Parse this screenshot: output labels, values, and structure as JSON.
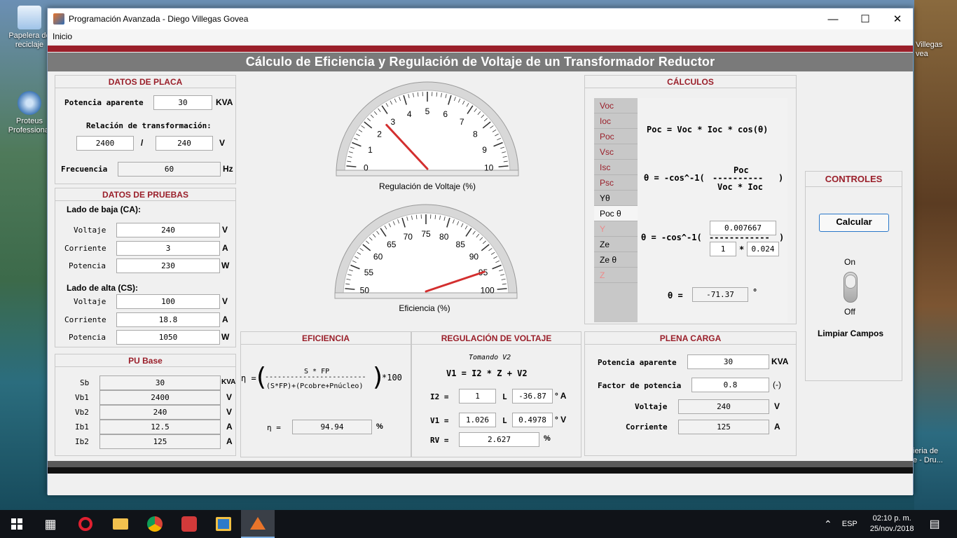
{
  "desktop": {
    "icons": [
      {
        "label": "Papelera de reciclaje"
      },
      {
        "label": "Proteus Professional"
      }
    ],
    "right_labels": [
      "Villegas",
      "vea",
      "ieria de",
      "e - Dru..."
    ]
  },
  "window": {
    "title": "Programación Avanzada - Diego Villegas Govea",
    "menu": [
      "Inicio"
    ],
    "header": "Cálculo de Eficiencia y Regulación de Voltaje de un Transformador Reductor"
  },
  "placa": {
    "title": "DATOS DE PLACA",
    "potencia_label": "Potencia aparente",
    "potencia_value": "30",
    "potencia_unit": "KVA",
    "relacion_label": "Relación de transformación:",
    "rel_primary": "2400",
    "rel_sep": "/",
    "rel_secondary": "240",
    "rel_unit": "V",
    "frecuencia_label": "Frecuencia",
    "frecuencia_value": "60",
    "frecuencia_unit": "Hz"
  },
  "pruebas": {
    "title": "DATOS DE PRUEBAS",
    "baja_title": "Lado de baja (CA):",
    "baja": [
      {
        "label": "Voltaje",
        "value": "240",
        "unit": "V"
      },
      {
        "label": "Corriente",
        "value": "3",
        "unit": "A"
      },
      {
        "label": "Potencia",
        "value": "230",
        "unit": "W"
      }
    ],
    "alta_title": "Lado de alta (CS):",
    "alta": [
      {
        "label": "Voltaje",
        "value": "100",
        "unit": "V"
      },
      {
        "label": "Corriente",
        "value": "18.8",
        "unit": "A"
      },
      {
        "label": "Potencia",
        "value": "1050",
        "unit": "W"
      }
    ]
  },
  "pu": {
    "title": "PU Base",
    "rows": [
      {
        "label": "Sb",
        "value": "30",
        "unit": "KVA"
      },
      {
        "label": "Vb1",
        "value": "2400",
        "unit": "V"
      },
      {
        "label": "Vb2",
        "value": "240",
        "unit": "V"
      },
      {
        "label": "Ib1",
        "value": "12.5",
        "unit": "A"
      },
      {
        "label": "Ib2",
        "value": "125",
        "unit": "A"
      }
    ]
  },
  "gauges": {
    "regulacion": {
      "caption": "Regulación de Voltaje (%)",
      "ticks": [
        "0",
        "1",
        "2",
        "3",
        "4",
        "5",
        "6",
        "7",
        "8",
        "9",
        "10"
      ],
      "min": 0,
      "max": 10,
      "value": 2.627
    },
    "eficiencia": {
      "caption": "Eficiencia (%)",
      "ticks": [
        "50",
        "55",
        "60",
        "65",
        "70",
        "75",
        "80",
        "85",
        "90",
        "95",
        "100"
      ],
      "min": 50,
      "max": 100,
      "value": 94.94
    }
  },
  "eficiencia": {
    "title": "EFICIENCIA",
    "eta": "η =",
    "numerator": "S * FP",
    "denominator": "(S*FP)+(Pcobre+Pnúcleo)",
    "times": "*100",
    "result_label": "η =",
    "result_value": "94.94",
    "result_unit": "%"
  },
  "regulacion": {
    "title": "REGULACIÓN DE VOLTAJE",
    "subtitle": "Tomando V2",
    "formula": "V1 = I2 * Z + V2",
    "i2_label": "I2 =",
    "i2_mag": "1",
    "i2_angle_sym": "L",
    "i2_angle": "-36.87",
    "i2_unit": "° A",
    "v1_label": "V1 =",
    "v1_mag": "1.026",
    "v1_angle_sym": "L",
    "v1_angle": "0.4978",
    "v1_unit": "° V",
    "rv_label": "RV =",
    "rv_value": "2.627",
    "rv_unit": "%"
  },
  "calculos": {
    "title": "CÁLCULOS",
    "items": [
      "Voc",
      "Ioc",
      "Poc",
      "Vsc",
      "Isc",
      "Psc",
      "Yθ",
      "Poc θ",
      "Y",
      "Ze",
      "Ze θ",
      "Z"
    ],
    "selected": "Poc θ",
    "eq1": "Poc = Voc * Ioc * cos(θ)",
    "eq2_prefix": "θ = -cos^-1(",
    "eq2_num": "Poc",
    "eq2_den": "Voc * Ioc",
    "eq2_suffix": ")",
    "eq3_prefix": "θ = -cos^-1(",
    "eq3_num": "0.007667",
    "eq3_den_a": "1",
    "eq3_star": "*",
    "eq3_den_b": "0.024",
    "eq3_suffix": ")",
    "theta_label": "θ =",
    "theta_value": "-71.37",
    "theta_unit": "°"
  },
  "plena": {
    "title": "PLENA CARGA",
    "rows": [
      {
        "label": "Potencia aparente",
        "value": "30",
        "unit": "KVA"
      },
      {
        "label": "Factor de potencia",
        "value": "0.8",
        "unit": "(-)"
      },
      {
        "label": "Voltaje",
        "value": "240",
        "unit": "V"
      },
      {
        "label": "Corriente",
        "value": "125",
        "unit": "A"
      }
    ]
  },
  "controles": {
    "title": "CONTROLES",
    "calcular": "Calcular",
    "on": "On",
    "off": "Off",
    "limpiar": "Limpiar Campos"
  },
  "taskbar": {
    "lang": "ESP",
    "time": "02:10 p. m.",
    "date": "25/nov./2018"
  }
}
